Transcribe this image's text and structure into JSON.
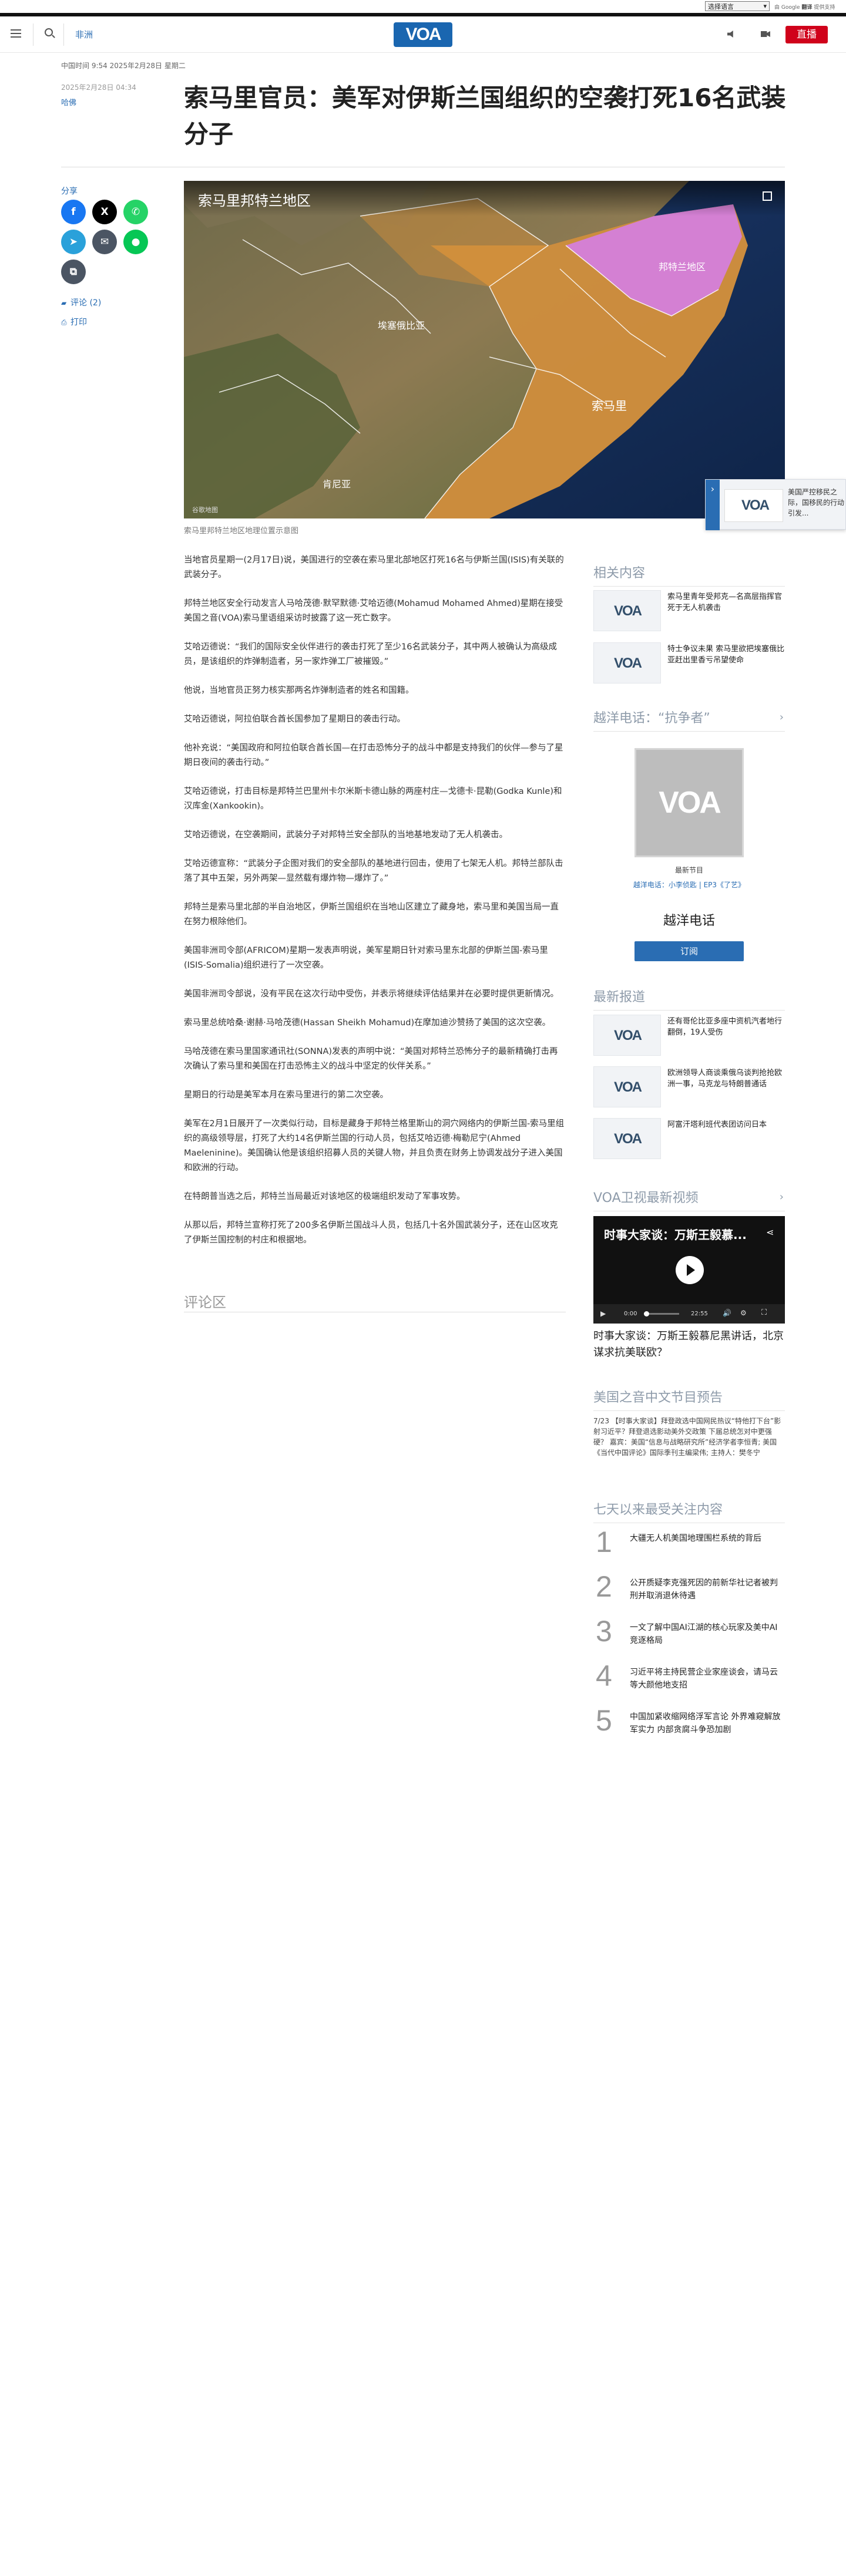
{
  "topbar": {
    "language_select": "选择语言",
    "google_prefix": "由 Google",
    "google_brand": "翻译",
    "google_suffix": "提供支持"
  },
  "header": {
    "region_link": "非洲",
    "logo": "VOA",
    "live_button": "直播"
  },
  "article": {
    "datetime_top": "中国时间 9:54 2025年2月28日 星期二",
    "published": "2025年2月28日 04:34",
    "category": "哈佛",
    "title": "索马里官员：美军对伊斯兰国组织的空袭打死16名武装分子",
    "share_label": "分享",
    "comments_link": "评论 (2)",
    "print_link": "打印",
    "image_overlay_title": "索马里邦特兰地区",
    "image_source": "谷歌地图",
    "map_labels": {
      "puntland": "邦特兰地区",
      "ethiopia": "埃塞俄比亚",
      "somalia": "索马里",
      "kenya": "肯尼亚"
    },
    "image_caption": "索马里邦特兰地区地理位置示意图",
    "paragraphs": [
      "当地官员星期一(2月17日)说，美国进行的空袭在索马里北部地区打死16名与伊斯兰国(ISIS)有关联的武装分子。",
      "邦特兰地区安全行动发言人马哈茂德·默罕默德·艾哈迈德(Mohamud Mohamed Ahmed)星期在接受美国之音(VOA)索马里语组采访时披露了这一死亡数字。",
      "艾哈迈德说：“我们的国际安全伙伴进行的袭击打死了至少16名武装分子，其中两人被确认为高级成员，是该组织的炸弹制造者，另一家炸弹工厂被摧毁。”",
      "他说，当地官员正努力核实那两名炸弹制造者的姓名和国籍。",
      "艾哈迈德说，阿拉伯联合酋长国参加了星期日的袭击行动。",
      "他补充说：“美国政府和阿拉伯联合酋长国—在打击恐怖分子的战斗中都是支持我们的伙伴—参与了星期日夜间的袭击行动。”",
      "艾哈迈德说，打击目标是邦特兰巴里州卡尔米斯卡德山脉的两座村庄—戈德卡·昆勒(Godka Kunle)和汉库金(Xankookin)。",
      "艾哈迈德说，在空袭期间，武装分子对邦特兰安全部队的当地基地发动了无人机袭击。",
      "艾哈迈德宣称：“武装分子企图对我们的安全部队的基地进行回击，使用了七架无人机。邦特兰部队击落了其中五架，另外两架—显然载有爆炸物—爆炸了。”",
      "邦特兰是索马里北部的半自治地区，伊斯兰国组织在当地山区建立了藏身地，索马里和美国当局一直在努力根除他们。",
      "美国非洲司令部(AFRICOM)星期一发表声明说，美军星期日针对索马里东北部的伊斯兰国-索马里(ISIS-Somalia)组织进行了一次空袭。",
      "美国非洲司令部说，没有平民在这次行动中受伤，并表示将继续评估结果并在必要时提供更新情况。",
      "索马里总统哈桑·谢赫·马哈茂德(Hassan Sheikh Mohamud)在摩加迪沙赞扬了美国的这次空袭。",
      "马哈茂德在索马里国家通讯社(SONNA)发表的声明中说：“美国对邦特兰恐怖分子的最新精确打击再次确认了索马里和美国在打击恐怖主义的战斗中坚定的伙伴关系。”",
      "星期日的行动是美军本月在索马里进行的第二次空袭。",
      "美军在2月1日展开了一次类似行动，目标是藏身于邦特兰格里斯山的洞穴网络内的伊斯兰国-索马里组织的高级领导层，打死了大约14名伊斯兰国的行动人员，包括艾哈迈德·梅勒尼宁(Ahmed Maeleninine)。美国确认他是该组织招募人员的关键人物，并且负责在财务上协调发战分子进入美国和欧洲的行动。",
      "在特朗普当选之后，邦特兰当局最近对该地区的极端组织发动了军事攻势。",
      "从那以后，邦特兰宣称打死了200多名伊斯兰国战斗人员，包括几十名外国武装分子，还在山区攻克了伊斯兰国控制的村庄和根据地。"
    ],
    "comments_title": "评论区"
  },
  "floating_card": {
    "text": "美国严控移民之际，国移民的行动引发..."
  },
  "sidebar": {
    "related_title": "相关内容",
    "related": [
      {
        "title": "索马里青年受邦克—名高层指挥官死于无人机袭击"
      },
      {
        "title": "特士争议未果 索马里欲把埃塞俄比亚赶出里香亏吊望使命"
      }
    ],
    "podcast_section_title": "越洋电话：“抗争者”",
    "podcast_kicker": "最新节目",
    "podcast_episode": "越洋电话：小李侦匙 | EP3《了艺》",
    "podcast_name": "越洋电话",
    "subscribe_button": "订阅",
    "latest_title": "最新报道",
    "latest": [
      {
        "title": "还有哥伦比亚多座中资机汽者地行翻倒，19人受伤"
      },
      {
        "title": "欧洲领导人商谈乘俄乌谈判抢抢欧洲一事，马克龙与特朗普通话"
      },
      {
        "title": "阿富汗塔利班代表团访问日本"
      }
    ],
    "video_section_title": "VOA卫视最新视频",
    "video_overlay_title": "时事大家谈：万斯王毅慕...",
    "video_time_current": "0:00",
    "video_time_total": "22:55",
    "video_caption": "时事大家谈：万斯王毅慕尼黑讲话，北京谋求抗美联欧？",
    "preview_title": "美国之音中文节目预告",
    "preview_text": "7/23 【时事大家谈】拜登政选中国网民热议“特他打下台”影射习近平？拜登退选影动美外交政策 下届总统怎对中更强硬？ 嘉宾：美国“信息与战略研究所”经济学者李恒青; 美国《当代中国评论》国际季刊主编梁伟; 主持人：樊冬宁",
    "popular_title": "七天以来最受关注内容",
    "popular": [
      {
        "num": "1",
        "title": "大疆无人机美国地理围栏系统的背后"
      },
      {
        "num": "2",
        "title": "公开质疑李克强死因的前新华社记者被判刑并取消退休待遇"
      },
      {
        "num": "3",
        "title": "一文了解中国AI江湖的核心玩家及美中AI竞逐格局"
      },
      {
        "num": "4",
        "title": "习近平将主持民营企业家座谈会，请马云等大颜他地支招"
      },
      {
        "num": "5",
        "title": "中国加紧收缩网络浮军言论 外界难窥解放军实力 内部贪腐斗争恐加剧"
      }
    ]
  }
}
